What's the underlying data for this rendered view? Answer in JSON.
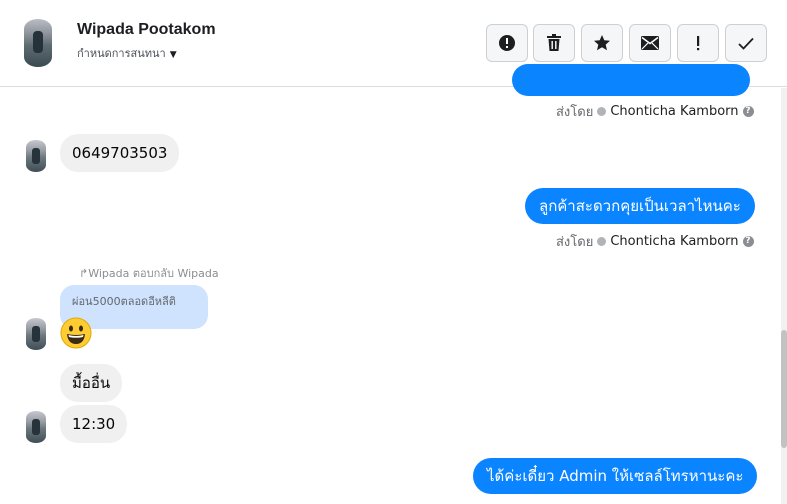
{
  "contact": {
    "name": "Wipada Pootakom",
    "subtitle": "กำหนดการสนทนา"
  },
  "toolbar": {
    "buttons": [
      {
        "name": "report-spam",
        "icon": "alert-circle-icon"
      },
      {
        "name": "delete",
        "icon": "trash-icon"
      },
      {
        "name": "star",
        "icon": "star-icon"
      },
      {
        "name": "mark-unread",
        "icon": "envelope-icon"
      },
      {
        "name": "mark-important",
        "icon": "exclamation-icon"
      },
      {
        "name": "mark-done",
        "icon": "check-icon"
      }
    ]
  },
  "messages": {
    "sent_by_label": "ส่งโดย",
    "agent_name": "Chonticha Kamborn",
    "incoming_phone": "0649703503",
    "outgoing_1": "ลูกค้าสะดวกคุยเป็นเวลาไหนคะ",
    "reply_hint": "↱Wipada ตอบกลับ Wipada",
    "replied_text": "ผ่อน5000ตลอดอีหลีติ",
    "incoming_2": "มื้ออื่น",
    "incoming_3": "12:30",
    "outgoing_2": "ได้ค่ะเดี๋ยว Admin ให้เซลล์โทรหานะคะ"
  }
}
